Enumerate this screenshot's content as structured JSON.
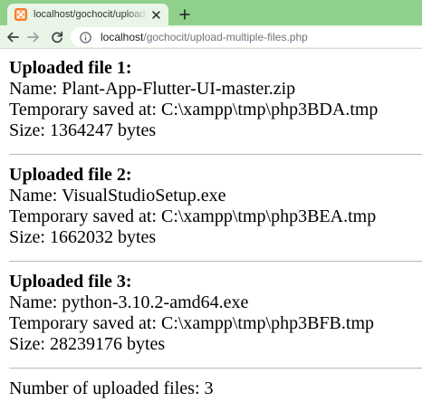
{
  "browser": {
    "tab_title": "localhost/gochocit/upload-multip",
    "url_host": "localhost",
    "url_path": "/gochocit/upload-multiple-files.php",
    "colors": {
      "tab_strip": "#8fd18b",
      "toolbar": "#e9f5e7",
      "favicon": "#fb7a24"
    },
    "icons": [
      "xampp-favicon-icon",
      "close-icon",
      "plus-icon",
      "back-arrow-icon",
      "forward-arrow-icon",
      "reload-icon",
      "info-icon"
    ]
  },
  "files": [
    {
      "heading": "Uploaded file 1:",
      "name_line": "Name: Plant-App-Flutter-UI-master.zip",
      "temp_line": "Temporary saved at: C:\\xampp\\tmp\\php3BDA.tmp",
      "size_line": "Size: 1364247 bytes"
    },
    {
      "heading": "Uploaded file 2:",
      "name_line": "Name: VisualStudioSetup.exe",
      "temp_line": "Temporary saved at: C:\\xampp\\tmp\\php3BEA.tmp",
      "size_line": "Size: 1662032 bytes"
    },
    {
      "heading": "Uploaded file 3:",
      "name_line": "Name: python-3.10.2-amd64.exe",
      "temp_line": "Temporary saved at: C:\\xampp\\tmp\\php3BFB.tmp",
      "size_line": "Size: 28239176 bytes"
    }
  ],
  "summary": "Number of uploaded files: 3"
}
